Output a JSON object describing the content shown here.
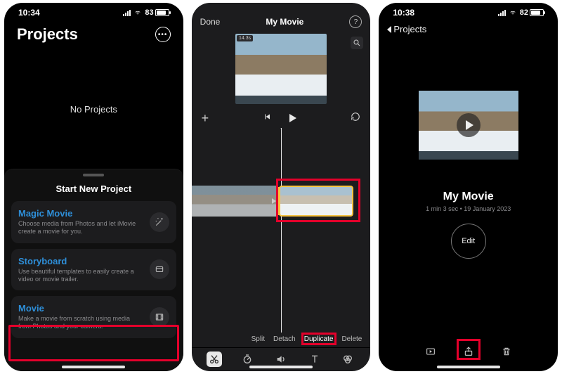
{
  "screen1": {
    "status": {
      "time": "10:34",
      "battery": "83",
      "battery_fill": "83%"
    },
    "title": "Projects",
    "empty_text": "No Projects",
    "sheet_title": "Start New Project",
    "options": [
      {
        "title": "Magic Movie",
        "sub": "Choose media from Photos and let iMovie create a movie for you."
      },
      {
        "title": "Storyboard",
        "sub": "Use beautiful templates to easily create a video or movie trailer."
      },
      {
        "title": "Movie",
        "sub": "Make a movie from scratch using media from Photos and your camera."
      }
    ]
  },
  "screen2": {
    "done": "Done",
    "title": "My Movie",
    "clip_time": "14.3s",
    "actions": {
      "split": "Split",
      "detach": "Detach",
      "duplicate": "Duplicate",
      "delete": "Delete"
    }
  },
  "screen3": {
    "status": {
      "time": "10:38",
      "battery": "82",
      "battery_fill": "82%"
    },
    "back": "Projects",
    "title": "My Movie",
    "meta": "1 min 3 sec • 19 January 2023",
    "edit": "Edit"
  },
  "colors": {
    "accent_blue": "#2e8fd9",
    "highlight": "#e4002b",
    "selection": "#f6c340"
  }
}
